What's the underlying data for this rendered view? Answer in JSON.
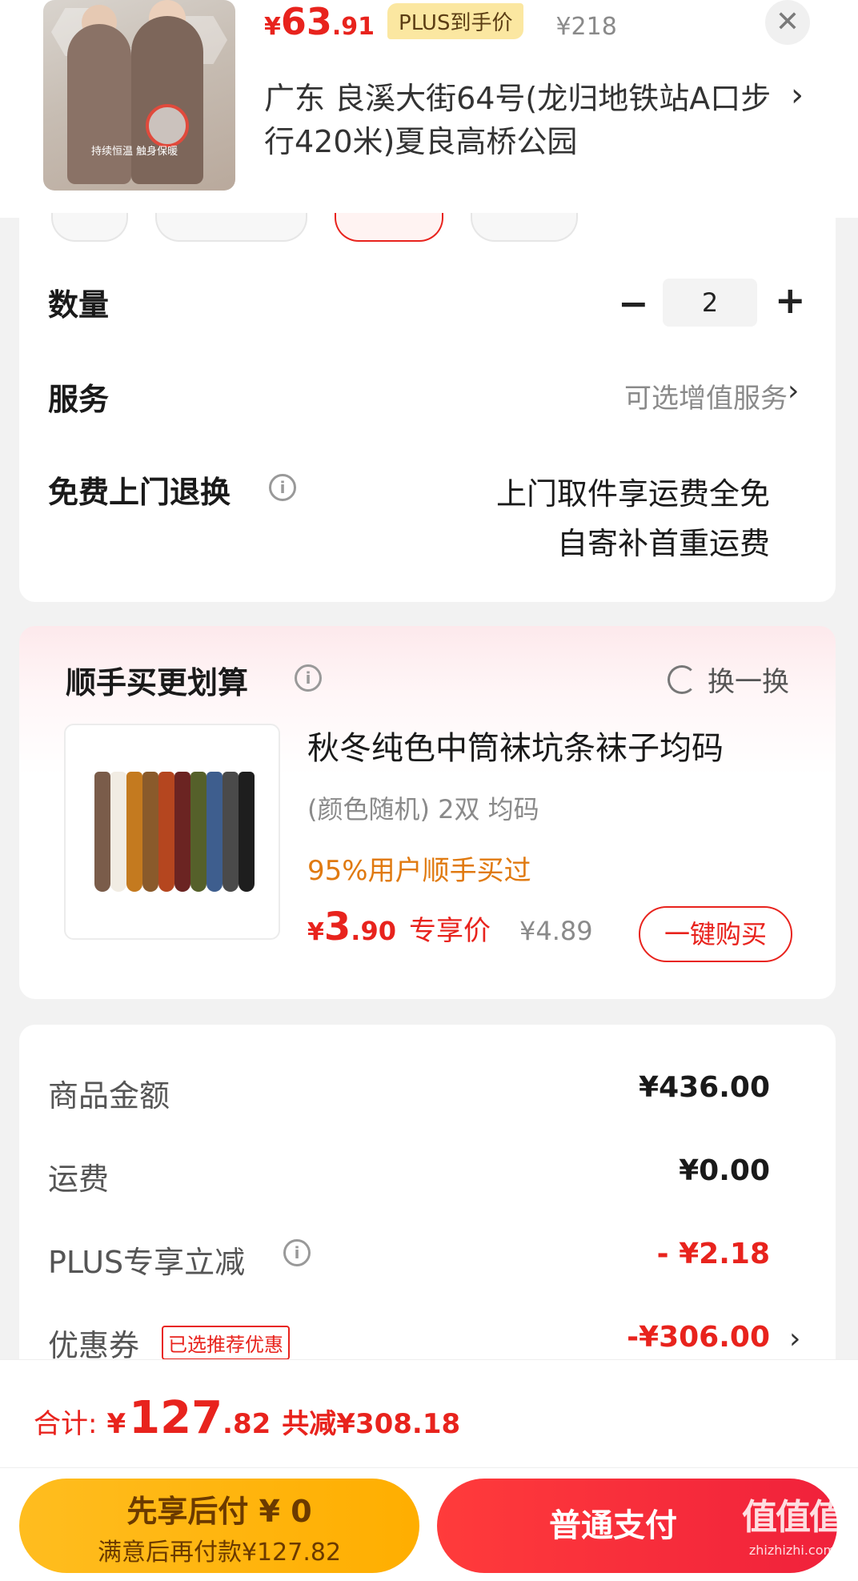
{
  "header": {
    "price_currency": "¥",
    "price_int": "63",
    "price_dec": ".91",
    "plus_label": "PLUS到手价",
    "original_price": "¥218",
    "address": "广东  良溪大街64号(龙归地铁站A口步行420米)夏良高桥公园",
    "thumb_caption": "持续恒温  触身保暖"
  },
  "quantity": {
    "label": "数量",
    "value": "2",
    "minus": "−",
    "plus": "+"
  },
  "service": {
    "label": "服务",
    "value": "可选增值服务"
  },
  "free_return": {
    "label": "免费上门退换",
    "line1": "上门取件享运费全免",
    "line2": "自寄补首重运费"
  },
  "recommend": {
    "title": "顺手买更划算",
    "refresh_label": "换一换",
    "product_name": "秋冬纯色中筒袜坑条袜子均码",
    "spec": "(颜色随机) 2双   均码",
    "buy_pct": "95%用户顺手买过",
    "price_currency": "¥",
    "price_int": "3",
    "price_dec": ".90",
    "price_tag": "专享价",
    "original_price": "¥4.89",
    "buy_button": "一键购买"
  },
  "fees": {
    "goods_label": "商品金额",
    "goods_value": "¥436.00",
    "shipping_label": "运费",
    "shipping_value": "¥0.00",
    "plus_label": "PLUS专享立减",
    "plus_value": "- ¥2.18",
    "coupon_label": "优惠券",
    "coupon_tag": "已选推荐优惠",
    "coupon_value": "-¥306.00"
  },
  "bottom": {
    "total_label": "合计:",
    "total_currency": "¥",
    "total_int": "127",
    "total_dec": ".82",
    "saved": "共减¥308.18",
    "later_line1": "先享后付 ¥ 0",
    "later_line2": "满意后再付款¥127.82",
    "pay_button": "普通支付",
    "watermark_main": "值值值",
    "watermark_sub": "zhizhizhi.com"
  },
  "colors": {
    "accent": "#e8231d",
    "plus_gold": "#fbe7a1",
    "pay_later": "#ffb400"
  }
}
